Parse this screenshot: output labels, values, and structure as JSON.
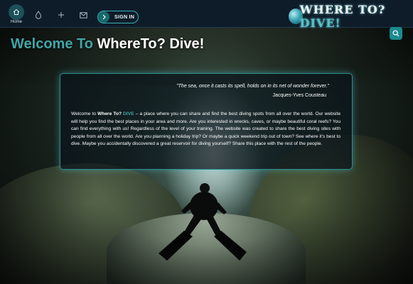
{
  "nav": {
    "home_label": "Home",
    "items": [
      {
        "icon": "drop-icon"
      },
      {
        "icon": "plus-icon"
      },
      {
        "icon": "mail-icon"
      }
    ],
    "signin_label": "SIGN IN"
  },
  "logo": {
    "main": "WHERE TO?",
    "accent": "DIVE!"
  },
  "hero": {
    "prefix": "Welcome To",
    "name": "WhereTo? Dive!"
  },
  "quote": {
    "text": "\"The sea, once it casts its spell, holds on in its net of wonder forever.\"",
    "author": "Jacques-Yves Cousteau"
  },
  "intro": {
    "lead": "Welcome to",
    "brand": "Where To?",
    "brand_accent": "DIVE",
    "body": " – a place where you can share and find the best diving spots from all over the world. Our website will help you find the best places in your area and more. Are you interested in wrecks, caves, or maybe beautiful coral reefs? You can find everything with us! Regardless of the level of your training. The website was created to share the best diving sites with people from all over the world. Are you planning a holiday trip? Or maybe a quick weekend trip out of town? See where it's best to dive. Maybe you accidentally discovered a great reservoir for diving yourself? Share this place with the rest of the people."
  },
  "colors": {
    "accent": "#3fa6a8",
    "navbar": "#0e1c2a",
    "button_border": "#34b4b4"
  }
}
